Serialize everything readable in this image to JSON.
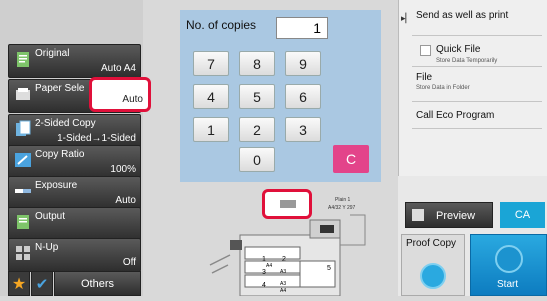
{
  "left": {
    "original": {
      "label": "Original",
      "value": "Auto A4"
    },
    "paper_select": {
      "label": "Paper Sele",
      "value": "Auto"
    },
    "two_sided": {
      "label": "2-Sided Copy",
      "value": "1-Sided→1-Sided"
    },
    "copy_ratio": {
      "label": "Copy Ratio",
      "value": "100%"
    },
    "exposure": {
      "label": "Exposure",
      "value": "Auto"
    },
    "output": {
      "label": "Output",
      "value": ""
    },
    "nup": {
      "label": "N-Up",
      "value": "Off"
    },
    "others_label": "Others"
  },
  "keypad": {
    "copies_label": "No. of copies",
    "copies_value": "1",
    "keys": [
      "7",
      "8",
      "9",
      "4",
      "5",
      "6",
      "1",
      "2",
      "3",
      "0"
    ],
    "clear_label": "C"
  },
  "device": {
    "tray1": "Plain 1",
    "tray1_size": "A4/32 Y 297",
    "tray_labels": [
      "1",
      "2",
      "3",
      "4",
      "5"
    ],
    "size_labels": [
      "A4",
      "A3",
      "A3",
      "A4"
    ]
  },
  "right": {
    "send_label": "Send as well as print",
    "quick_file": "Quick File",
    "quick_file_sub": "Store Data Temporarily",
    "file": "File",
    "file_sub": "Store Data in Folder",
    "eco": "Call Eco Program",
    "preview": "Preview",
    "ca": "CA",
    "proof_copy": "Proof Copy",
    "start": "Start"
  },
  "colors": {
    "highlight": "#e0103a",
    "keypad_bg": "#aac8e2",
    "clear_key": "#e3448a",
    "start": "#1aa5d6"
  }
}
